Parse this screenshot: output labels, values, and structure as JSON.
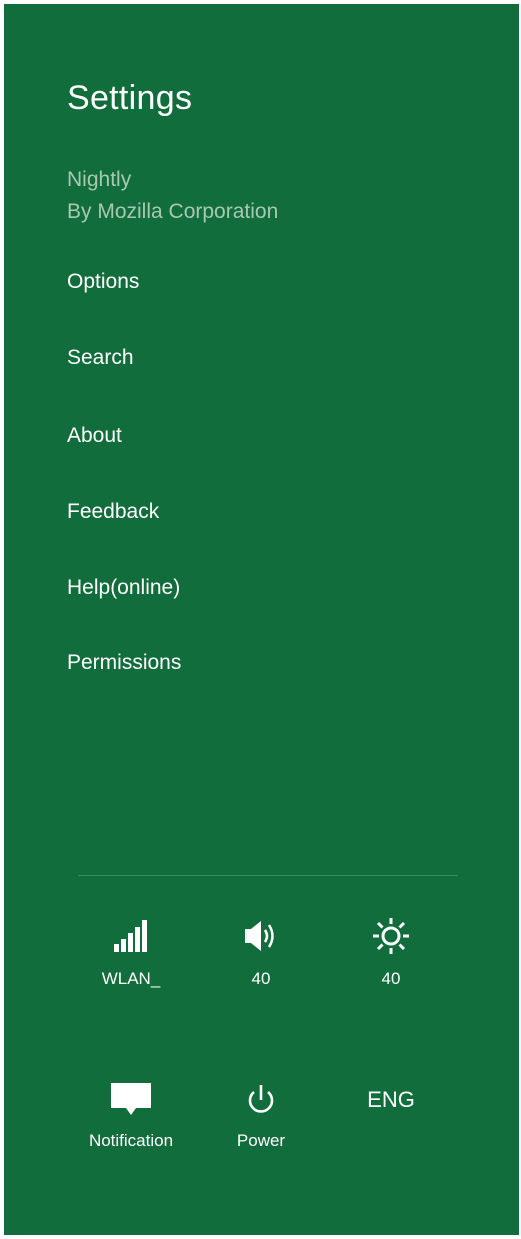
{
  "colors": {
    "panel_background": "#116d3b",
    "secondary_text": "#a7c8b1",
    "divider": "#3e8b5f",
    "text": "#ffffff"
  },
  "panel": {
    "title": "Settings",
    "app_name": "Nightly",
    "app_publisher": "By Mozilla Corporation"
  },
  "menu": {
    "items": [
      {
        "label": "Options"
      },
      {
        "label": "Search"
      },
      {
        "label": "About"
      },
      {
        "label": "Feedback"
      },
      {
        "label": "Help(online)"
      },
      {
        "label": "Permissions"
      }
    ]
  },
  "quick_settings": {
    "network": {
      "icon": "signal-bars-icon",
      "label": "WLAN_"
    },
    "volume": {
      "icon": "speaker-icon",
      "label": "40"
    },
    "brightness": {
      "icon": "sun-icon",
      "label": "40"
    },
    "notifications": {
      "icon": "notification-icon",
      "label": "Notification"
    },
    "power": {
      "icon": "power-icon",
      "label": "Power"
    },
    "keyboard": {
      "label": "ENG"
    }
  }
}
